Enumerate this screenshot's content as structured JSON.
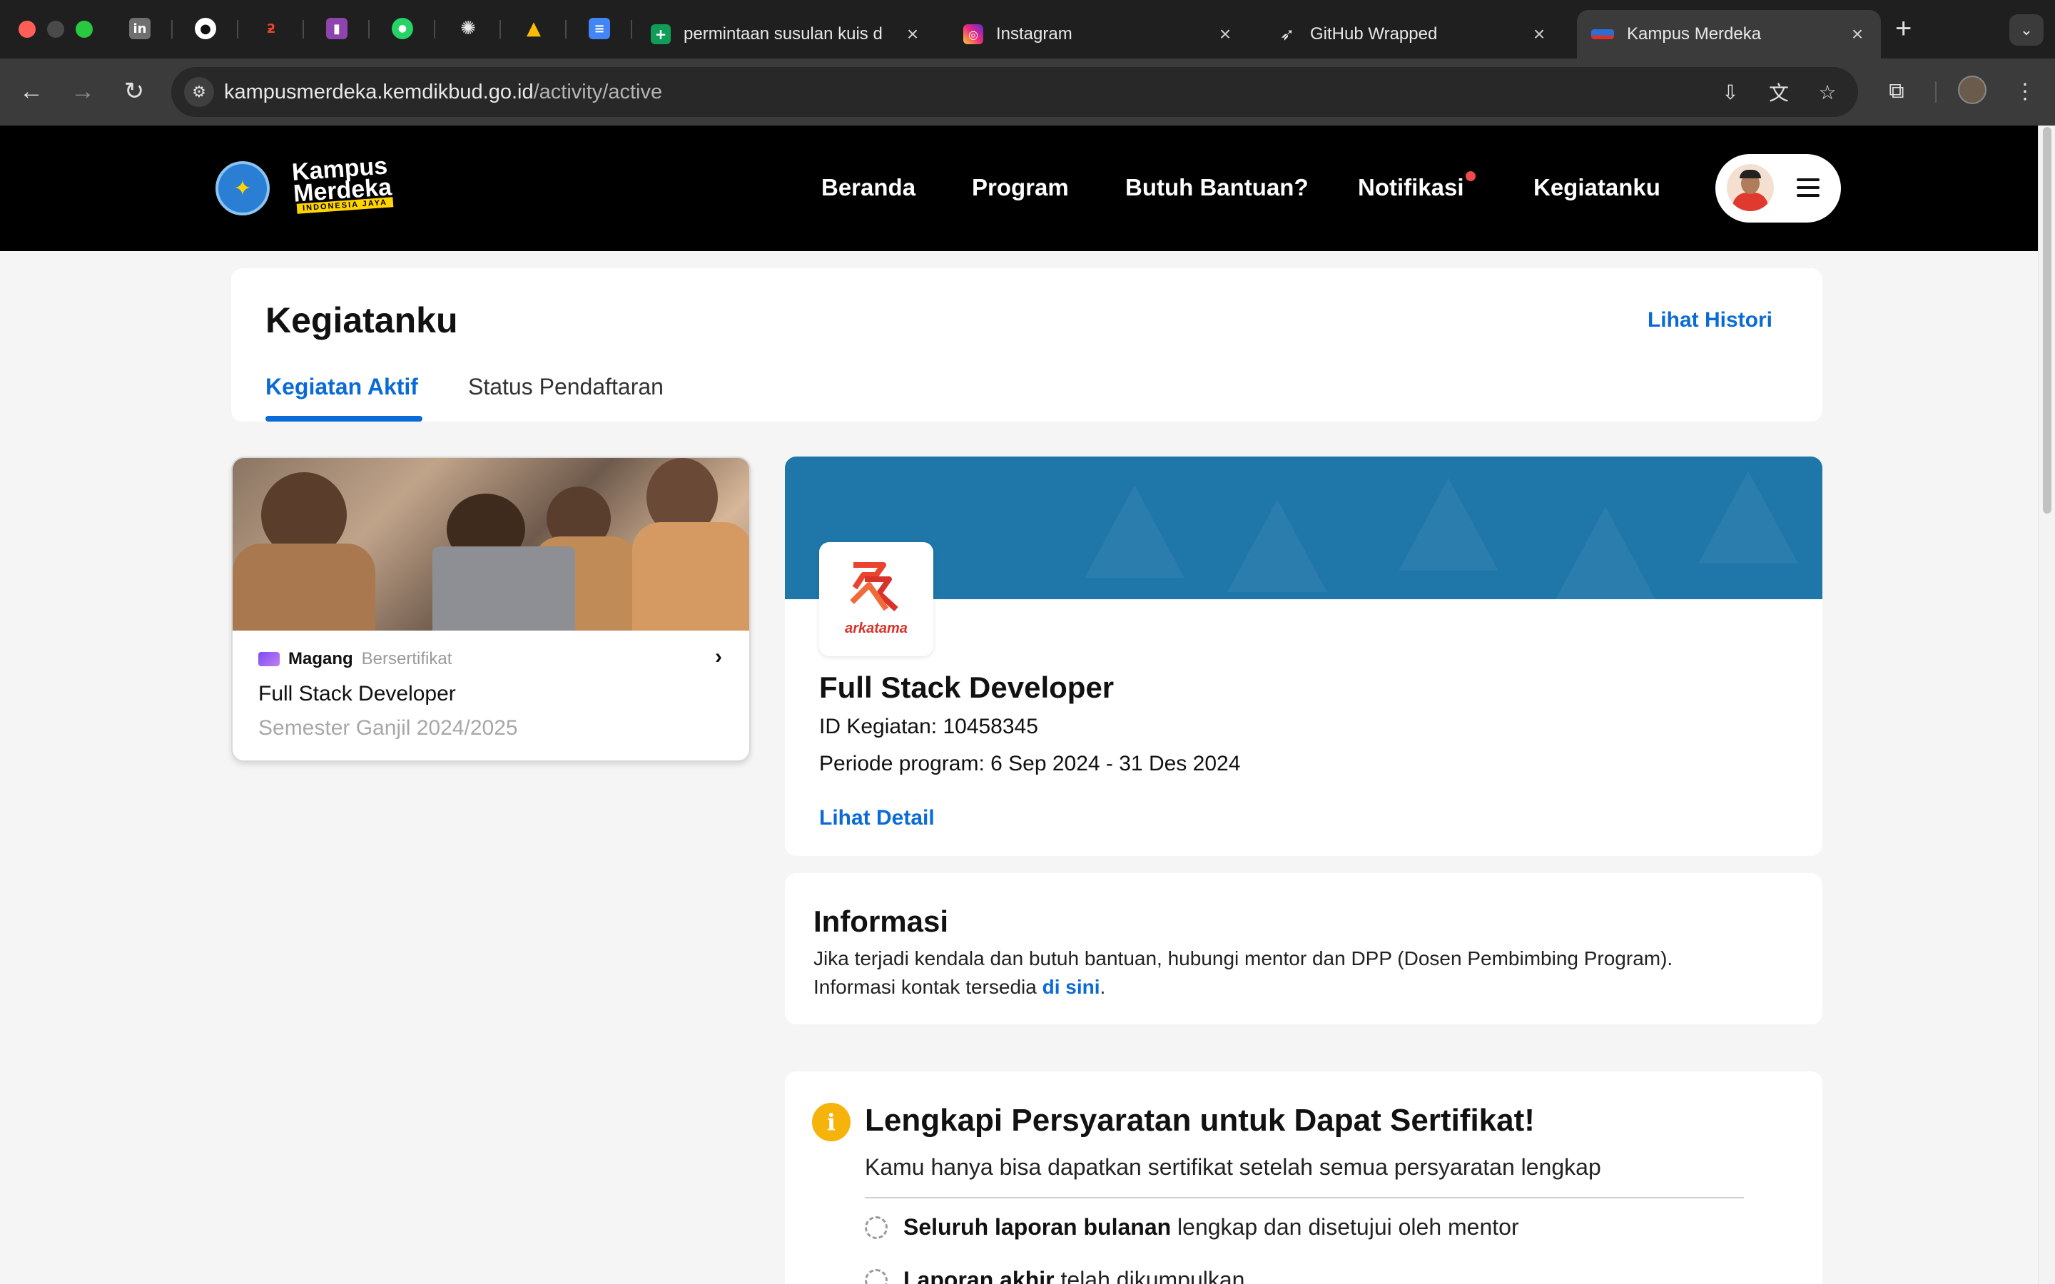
{
  "browser": {
    "tabs": [
      {
        "title": "permintaan susulan kuis d",
        "close": "×"
      },
      {
        "title": "Instagram",
        "close": "×"
      },
      {
        "title": "GitHub Wrapped",
        "close": "×"
      },
      {
        "title": "Kampus Merdeka",
        "close": "×"
      }
    ],
    "pinned_icons": [
      "linkedin-icon",
      "github-icon",
      "arkatama-icon",
      "trello-icon",
      "whatsapp-icon",
      "chatgpt-icon",
      "google-drive-icon",
      "google-docs-icon"
    ],
    "new_tab": "+",
    "url_host": "kampusmerdeka.kemdikbud.go.id",
    "url_path": "/activity/active"
  },
  "header": {
    "logo_line1": "Kampus",
    "logo_line2": "Merdeka",
    "logo_sub": "INDONESIA JAYA",
    "nav": [
      "Beranda",
      "Program",
      "Butuh Bantuan?",
      "Notifikasi",
      "Kegiatanku"
    ],
    "has_notification": true
  },
  "page": {
    "title": "Kegiatanku",
    "history_link": "Lihat Histori",
    "tabs": [
      {
        "label": "Kegiatan Aktif",
        "active": true
      },
      {
        "label": "Status Pendaftaran",
        "active": false
      }
    ]
  },
  "activity_card": {
    "type": "Magang",
    "type_sub": "Bersertifikat",
    "title": "Full Stack Developer",
    "semester": "Semester Ganjil 2024/2025"
  },
  "detail": {
    "company": "arkatama",
    "title": "Full Stack Developer",
    "id_line": "ID Kegiatan: 10458345",
    "period_line": "Periode program: 6 Sep 2024 - 31 Des 2024",
    "detail_link": "Lihat Detail"
  },
  "info": {
    "title": "Informasi",
    "line1": "Jika terjadi kendala dan butuh bantuan, hubungi mentor dan DPP (Dosen Pembimbing Program).",
    "line2_prefix": "Informasi kontak tersedia ",
    "line2_link": "di sini",
    "line2_suffix": "."
  },
  "requirements": {
    "icon": "i",
    "title": "Lengkapi Persyaratan untuk Dapat Sertifikat!",
    "subtitle": "Kamu hanya bisa dapatkan sertifikat setelah semua persyaratan lengkap",
    "items": [
      {
        "bold": "Seluruh laporan bulanan",
        "rest": " lengkap dan disetujui oleh mentor"
      },
      {
        "bold": "Laporan akhir",
        "rest": " telah dikumpulkan"
      }
    ]
  },
  "colors": {
    "accent": "#0a6bd6",
    "header_bg": "#000000",
    "banner": "#1f76a8",
    "warning": "#f5b30c",
    "notif_dot": "#f04a4a"
  }
}
